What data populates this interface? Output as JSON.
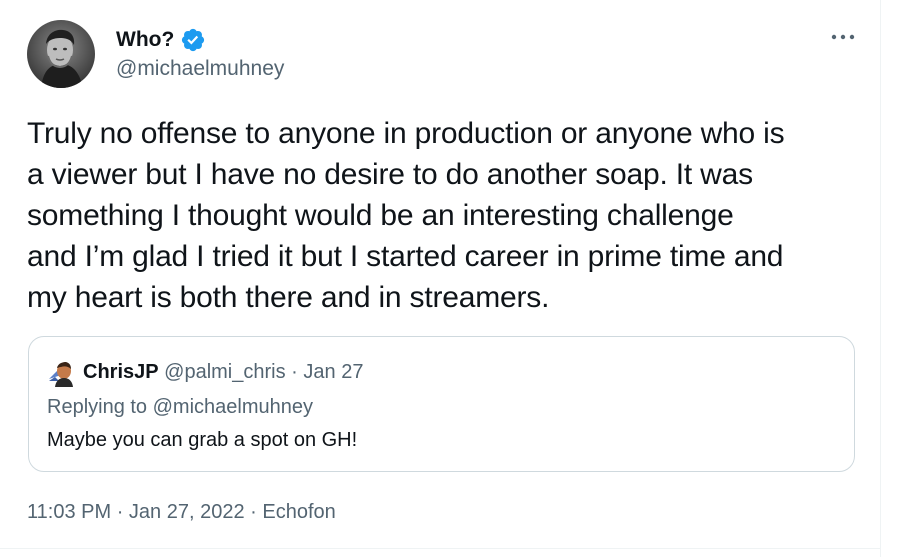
{
  "author": {
    "display_name": "Who?",
    "handle": "@michaelmuhney",
    "verified": true,
    "avatar_icon": "person-photo-icon"
  },
  "tweet": {
    "text": "Truly no offense to anyone in production or anyone who is\na viewer but I have no desire to do another soap. It was\nsomething I thought would be an interesting challenge\nand I’m glad I tried it but I started career in prime time and\nmy heart is both there and in streamers."
  },
  "quoted_tweet": {
    "display_name": "ChrisJP",
    "handle": "@palmi_chris",
    "separator": "·",
    "date": "Jan 27",
    "replying_prefix": "Replying to",
    "replying_to": "@michaelmuhney",
    "text": "Maybe you can grab a spot on GH!",
    "avatar_icon": "person-photo-icon"
  },
  "footer": {
    "time": "11:03 PM",
    "separator": "·",
    "date": "Jan 27, 2022",
    "source": "Echofon"
  },
  "colors": {
    "text_primary": "#0f1419",
    "text_secondary": "#536471",
    "verified_blue": "#1d9bf0",
    "border": "#cfd9de"
  }
}
